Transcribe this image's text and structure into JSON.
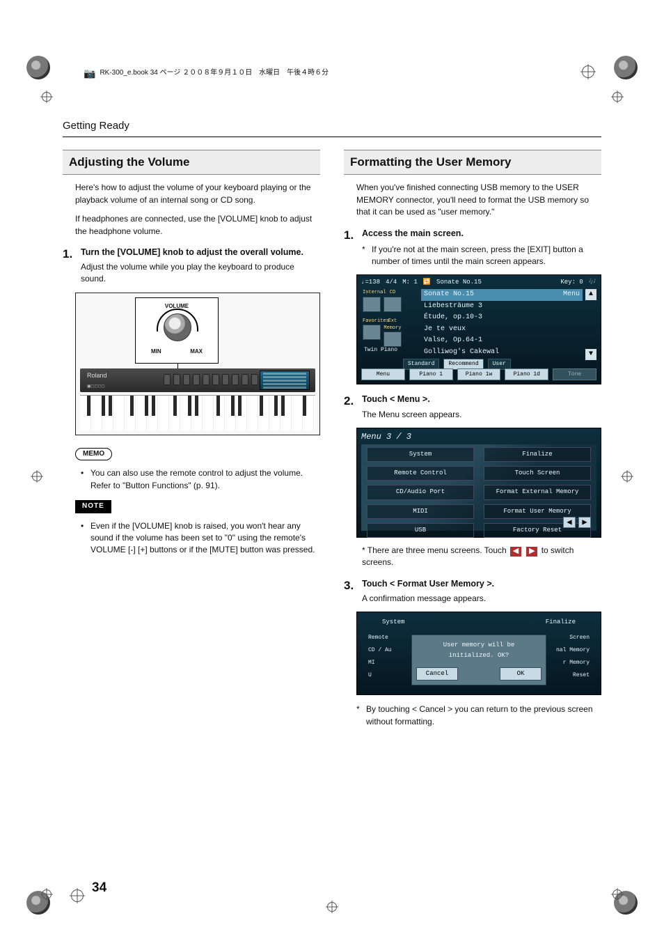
{
  "print_header": "RK-300_e.book  34 ページ  ２００８年９月１０日　水曜日　午後４時６分",
  "running_head": "Getting Ready",
  "page_number": "34",
  "left": {
    "heading": "Adjusting the Volume",
    "intro1": "Here's how to adjust the volume of your keyboard playing or the playback volume of an internal song or CD song.",
    "intro2": "If headphones are connected, use the [VOLUME] knob to adjust the headphone volume.",
    "steps": [
      {
        "num": "1.",
        "title": "Turn the [VOLUME] knob to adjust the overall volume.",
        "note": "Adjust the volume while you play the keyboard to produce sound."
      }
    ],
    "knob": {
      "label": "VOLUME",
      "min": "MIN",
      "max": "MAX",
      "brand": "Roland"
    },
    "memo_label": "MEMO",
    "memo_bullet": "You can also use the remote control to adjust the volume. Refer to \"Button Functions\" (p. 91).",
    "note_label": "NOTE",
    "note_bullet": "Even if the [VOLUME] knob is raised, you won't hear any sound if the volume has been set to \"0\" using the remote's VOLUME [-] [+] buttons or if the [MUTE] button was pressed."
  },
  "right": {
    "heading": "Formatting the User Memory",
    "intro": "When you've finished connecting USB memory to the USER MEMORY connector, you'll need to format the USB memory so that it can be used as \"user memory.\"",
    "step1": {
      "num": "1.",
      "title": "Access the main screen.",
      "note": "If you're not at the main screen, press the [EXIT] button a number of times until the main screen appears."
    },
    "screen1": {
      "tempo": "♩=138",
      "time": "4/4",
      "meas": "M:   1",
      "title_icon": "🔁",
      "title": "Sonate No.15",
      "key": "Key: 0",
      "thumbs": [
        {
          "a": "Internal",
          "b": "CD"
        },
        {
          "a": "Favorites",
          "b": "Ext Memory"
        }
      ],
      "twin": "Twin Piano",
      "highlight": {
        "name": "Sonate No.15",
        "badge": "Menu"
      },
      "songs": [
        "Liebesträume 3",
        "Étude, op.10-3",
        "Je te veux",
        "Valse, Op.64-1",
        "Golliwog's Cakewal"
      ],
      "tabs": [
        "Standard",
        "Recommend",
        "User"
      ],
      "bottom": [
        "Menu",
        "Piano 1",
        "Piano 1w",
        "Piano 1d",
        "Tone"
      ]
    },
    "step2": {
      "num": "2.",
      "title": "Touch < Menu >.",
      "note": "The Menu screen appears."
    },
    "screen2": {
      "title": "Menu 3 / 3",
      "items": [
        "System",
        "Finalize",
        "Remote Control",
        "Touch Screen",
        "CD/Audio Port",
        "Format External Memory",
        "MIDI",
        "Format User Memory",
        "USB",
        "Factory Reset"
      ]
    },
    "switch_note_a": "There are three menu screens. Touch",
    "switch_note_b": "to switch screens.",
    "step3": {
      "num": "3.",
      "title": "Touch < Format User Memory >.",
      "note": "A confirmation message appears."
    },
    "screen3": {
      "top_left": "System",
      "top_right": "Finalize",
      "left_items": [
        "Remote",
        "CD / Au",
        "MI",
        "U"
      ],
      "right_items": [
        "Screen",
        "nal Memory",
        "r Memory",
        "Reset"
      ],
      "dialog_line1": "User memory will be",
      "dialog_line2": "initialized. OK?",
      "cancel": "Cancel",
      "ok": "OK"
    },
    "cancel_note": "By touching < Cancel > you can return to the previous screen without formatting."
  }
}
